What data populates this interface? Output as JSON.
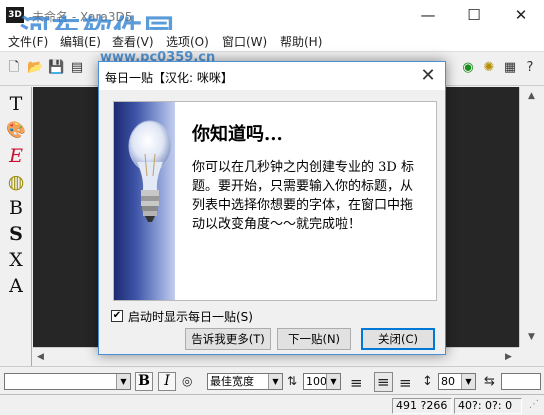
{
  "window": {
    "title": "未命名 - Xara3D5",
    "app_icon_text": "3D",
    "watermark": "河东软件园",
    "watermark_url": "www.pc0359.cn",
    "controls": {
      "minimize": "—",
      "maximize": "☐",
      "close": "✕"
    }
  },
  "menubar": {
    "items": [
      "文件(F)",
      "编辑(E)",
      "查看(V)",
      "选项(O)",
      "窗口(W)",
      "帮助(H)"
    ]
  },
  "toolbox": {
    "tools": [
      {
        "name": "text-tool-icon",
        "glyph": "T"
      },
      {
        "name": "color-palette-icon",
        "glyph": "🎨"
      },
      {
        "name": "extrude-tool-icon",
        "glyph": "E"
      },
      {
        "name": "bevel-tool-icon",
        "glyph": "◍"
      },
      {
        "name": "bold-font-tool-icon",
        "glyph": "B"
      },
      {
        "name": "shadow-tool-icon",
        "glyph": "S"
      },
      {
        "name": "texture-tool-icon",
        "glyph": "X"
      },
      {
        "name": "animation-tool-icon",
        "glyph": "A"
      }
    ]
  },
  "formatbar": {
    "font_value": "",
    "bold": "B",
    "italic": "I",
    "spacing_value": "最佳宽度",
    "size_value": "100",
    "line_spacing_value": "80",
    "align_left": "≡",
    "align_center": "≡",
    "align_right": "≡"
  },
  "statusbar": {
    "size": "491 ?266",
    "rotation": "40?: 0?: 0"
  },
  "dialog": {
    "title": "每日一贴【汉化: 咪咪】",
    "close": "✕",
    "heading": "你知道吗...",
    "body": "你可以在几秒钟之内创建专业的 3D 标题。要开始，只需要输入你的标题，从列表中选择你想要的字体，在窗口中拖动以改变角度～～就完成啦！",
    "show_on_startup_label": "启动时显示每日一贴(S)",
    "show_on_startup_checked": "✔",
    "buttons": {
      "more": "告诉我更多(T)",
      "next": "下一贴(N)",
      "close": "关闭(C)"
    },
    "accent": "#0078d7"
  }
}
